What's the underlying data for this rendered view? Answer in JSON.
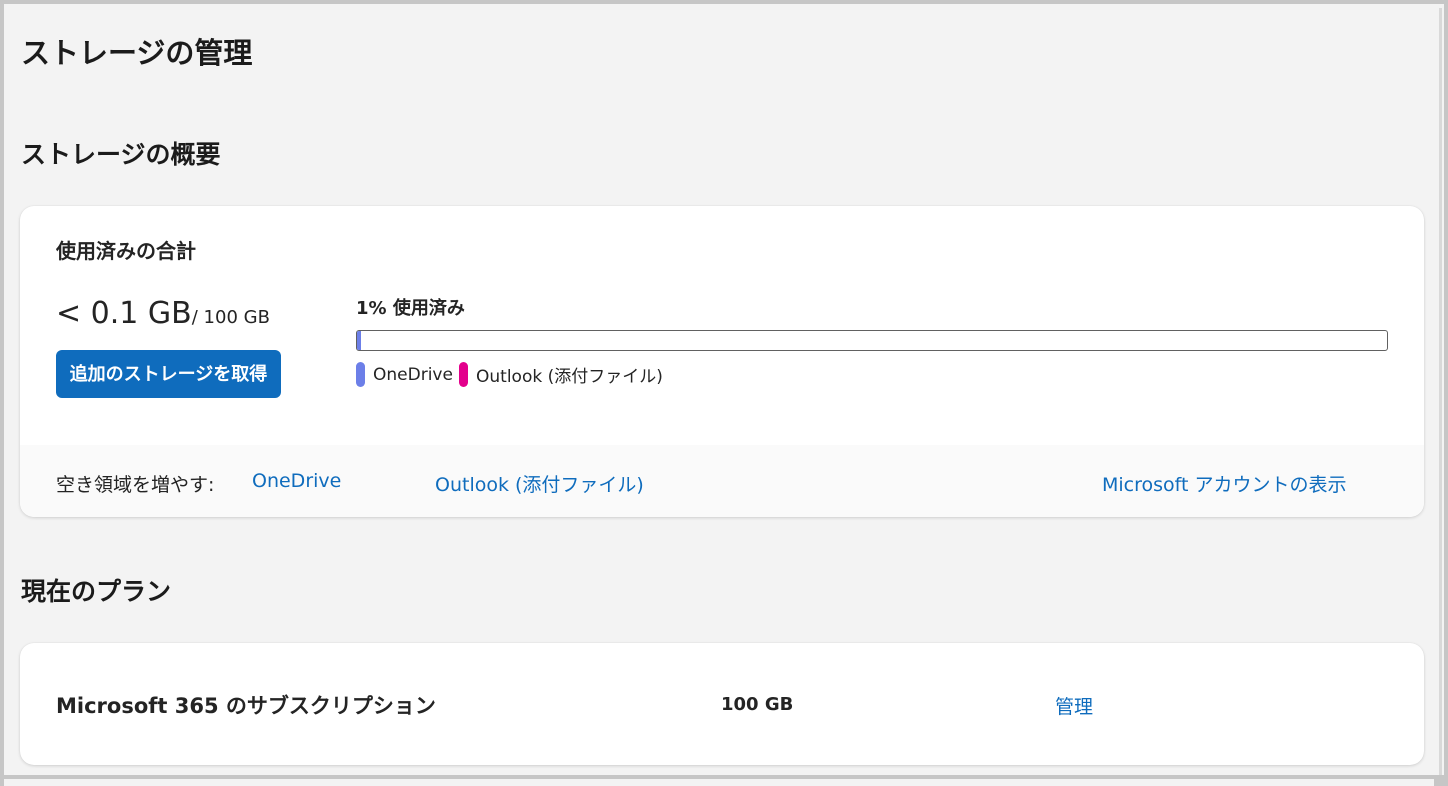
{
  "page": {
    "title": "ストレージの管理"
  },
  "overview": {
    "section_title": "ストレージの概要",
    "usage_heading": "使用済みの合計",
    "used": "< 0.1 GB",
    "total": "/ 100 GB",
    "get_storage_button": "追加のストレージを取得",
    "percent_label": "1% 使用済み",
    "progress_fraction": 0.004,
    "legend": [
      {
        "label": "OneDrive",
        "color": "#6c7fe8"
      },
      {
        "label": "Outlook (添付ファイル)",
        "color": "#e3008c"
      }
    ],
    "free_space_label": "空き領域を増やす:",
    "links": {
      "onedrive": "OneDrive",
      "outlook": "Outlook (添付ファイル)",
      "account": "Microsoft アカウントの表示"
    }
  },
  "plan": {
    "section_title": "現在のプラン",
    "name": "Microsoft 365 のサブスクリプション",
    "size": "100 GB",
    "manage": "管理"
  },
  "colors": {
    "accent": "#0f6cbd",
    "background": "#f3f3f3",
    "card": "#ffffff"
  }
}
